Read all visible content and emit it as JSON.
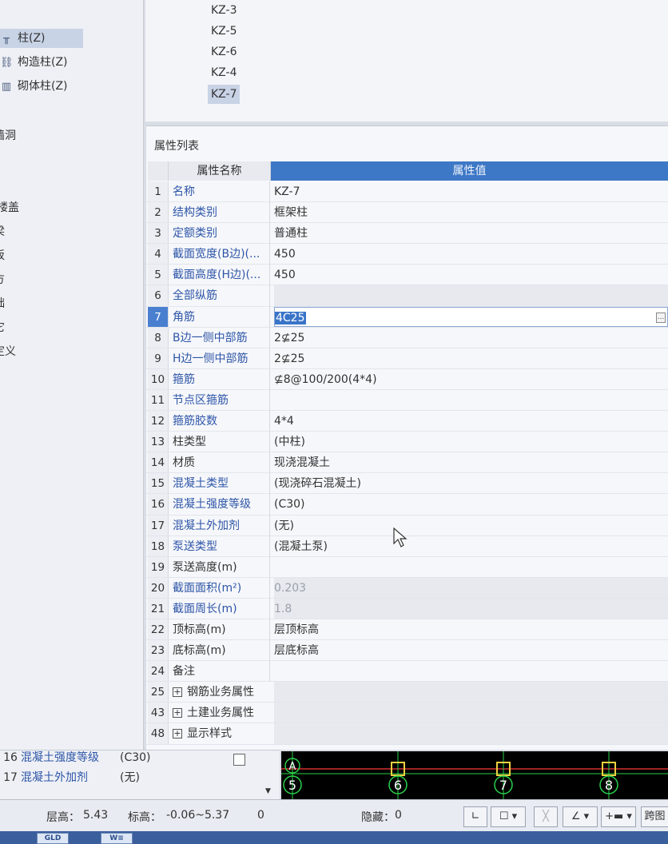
{
  "tree": {
    "items": [
      {
        "label": "柱(Z)",
        "icon": "column-icon",
        "selected": true
      },
      {
        "label": "构造柱(Z)",
        "icon": "construct-column-icon"
      },
      {
        "label": "砌体柱(Z)",
        "icon": "masonry-column-icon"
      }
    ],
    "fragments": [
      "墙洞",
      "楼盖",
      "梁",
      "板",
      "方",
      "础",
      "它",
      "定义"
    ]
  },
  "components": {
    "items": [
      "KZ-3",
      "KZ-5",
      "KZ-6",
      "KZ-4",
      "KZ-7"
    ],
    "selected": "KZ-7"
  },
  "props": {
    "title": "属性列表",
    "col_name": "属性名称",
    "col_value": "属性值",
    "rows": [
      {
        "idx": "1",
        "name": "名称",
        "value": "KZ-7",
        "blue": true
      },
      {
        "idx": "2",
        "name": "结构类别",
        "value": "框架柱",
        "blue": true
      },
      {
        "idx": "3",
        "name": "定额类别",
        "value": "普通柱",
        "blue": true
      },
      {
        "idx": "4",
        "name": "截面宽度(B边)(...",
        "value": "450",
        "blue": true
      },
      {
        "idx": "5",
        "name": "截面高度(H边)(...",
        "value": "450",
        "blue": true
      },
      {
        "idx": "6",
        "name": "全部纵筋",
        "value": "",
        "blue": true,
        "shade": true
      },
      {
        "idx": "7",
        "name": "角筋",
        "value": "4C25",
        "blue": true,
        "active": true
      },
      {
        "idx": "8",
        "name": "B边一侧中部筋",
        "value": "2⊈25",
        "blue": true
      },
      {
        "idx": "9",
        "name": "H边一侧中部筋",
        "value": "2⊈25",
        "blue": true
      },
      {
        "idx": "10",
        "name": "箍筋",
        "value": "⊈8@100/200(4*4)",
        "blue": true
      },
      {
        "idx": "11",
        "name": "节点区箍筋",
        "value": "",
        "blue": true
      },
      {
        "idx": "12",
        "name": "箍筋胶数",
        "value": "4*4",
        "blue": true
      },
      {
        "idx": "13",
        "name": "柱类型",
        "value": "(中柱)",
        "blue": false
      },
      {
        "idx": "14",
        "name": "材质",
        "value": "现浇混凝土",
        "blue": false
      },
      {
        "idx": "15",
        "name": "混凝土类型",
        "value": "(现浇碎石混凝土)",
        "blue": true
      },
      {
        "idx": "16",
        "name": "混凝土强度等级",
        "value": "(C30)",
        "blue": true
      },
      {
        "idx": "17",
        "name": "混凝土外加剂",
        "value": "(无)",
        "blue": true
      },
      {
        "idx": "18",
        "name": "泵送类型",
        "value": "(混凝土泵)",
        "blue": true
      },
      {
        "idx": "19",
        "name": "泵送高度(m)",
        "value": "",
        "blue": false
      },
      {
        "idx": "20",
        "name": "截面面积(m²)",
        "value": "0.203",
        "blue": true,
        "grey": true,
        "shade": true
      },
      {
        "idx": "21",
        "name": "截面周长(m)",
        "value": "1.8",
        "blue": true,
        "grey": true,
        "shade": true
      },
      {
        "idx": "22",
        "name": "顶标高(m)",
        "value": "层顶标高",
        "blue": false
      },
      {
        "idx": "23",
        "name": "底标高(m)",
        "value": "层底标高",
        "blue": false
      },
      {
        "idx": "24",
        "name": "备注",
        "value": "",
        "blue": false
      },
      {
        "idx": "25",
        "name": "钢筋业务属性",
        "value": "",
        "blue": false,
        "expand": true,
        "shade": true
      },
      {
        "idx": "43",
        "name": "土建业务属性",
        "value": "",
        "blue": false,
        "expand": true,
        "shade": true
      },
      {
        "idx": "48",
        "name": "显示样式",
        "value": "",
        "blue": false,
        "expand": true,
        "shade": true
      }
    ]
  },
  "mini_props": [
    {
      "idx": "16",
      "name": "混凝土强度等级",
      "value": "(C30)"
    },
    {
      "idx": "17",
      "name": "混凝土外加剂",
      "value": "(无)"
    }
  ],
  "axes": [
    "5",
    "6",
    "7",
    "8"
  ],
  "axis_marker": "A",
  "status": {
    "floor_height_label": "层高：",
    "floor_height": "5.43",
    "elevation_label": "标高：",
    "elevation": "-0.06~5.37",
    "count": "0",
    "hidden_label": "隐藏：",
    "hidden": "0",
    "stretch_label": "跨图"
  },
  "taskbar": [
    "GLD",
    "W≡"
  ]
}
